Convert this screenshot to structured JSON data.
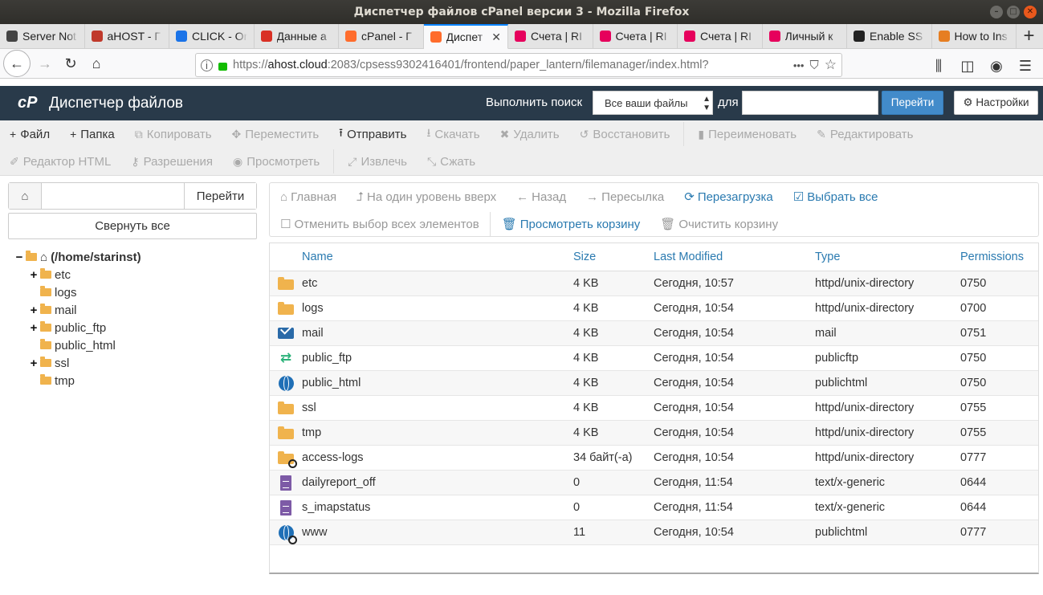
{
  "window": {
    "title": "Диспетчер файлов cPanel версии 3 - Mozilla Firefox"
  },
  "tabs": [
    {
      "label": "Server Not",
      "icon": "warning-icon",
      "color": "#444444"
    },
    {
      "label": "aHOST - Г",
      "icon": "ahost-icon",
      "color": "#c0392b"
    },
    {
      "label": "CLICK - On",
      "icon": "click-icon",
      "color": "#1a73e8"
    },
    {
      "label": "Данные а",
      "icon": "gmail-icon",
      "color": "#d93025"
    },
    {
      "label": "cPanel - Г",
      "icon": "cpanel-icon",
      "color": "#ff6c2c"
    },
    {
      "label": "Диспет",
      "icon": "cpanel-icon",
      "color": "#ff6c2c",
      "active": true
    },
    {
      "label": "Счета | RI",
      "icon": "ri-icon",
      "color": "#e6005c"
    },
    {
      "label": "Счета | RI",
      "icon": "ri-icon",
      "color": "#e6005c"
    },
    {
      "label": "Счета | RI",
      "icon": "ri-icon",
      "color": "#e6005c"
    },
    {
      "label": "Личный к",
      "icon": "ri-icon",
      "color": "#e6005c"
    },
    {
      "label": "Enable SS",
      "icon": "linux-icon",
      "color": "#222222"
    },
    {
      "label": "How to Ins",
      "icon": "howto-icon",
      "color": "#e67e22"
    }
  ],
  "url": {
    "prefix": "https://",
    "host": "ahost.cloud",
    "rest": ":2083/cpsess9302416401/frontend/paper_lantern/filemanager/index.html?",
    "dots": "•••"
  },
  "cpanel": {
    "logo": "cP",
    "title": "Диспетчер файлов",
    "search_label": "Выполнить поиск",
    "search_scope": "Все ваши файлы",
    "for_label": "для",
    "go": "Перейти",
    "settings": "Настройки"
  },
  "toolbar": {
    "row1": [
      {
        "label": "Файл",
        "icon": "+",
        "enabled": true
      },
      {
        "label": "Папка",
        "icon": "+",
        "enabled": true
      },
      {
        "label": "Копировать",
        "icon": "⧉",
        "enabled": false
      },
      {
        "label": "Переместить",
        "icon": "✥",
        "enabled": false
      },
      {
        "label": "Отправить",
        "icon": "⭱",
        "enabled": true
      },
      {
        "label": "Скачать",
        "icon": "⭳",
        "enabled": false
      },
      {
        "label": "Удалить",
        "icon": "✖",
        "enabled": false
      },
      {
        "label": "Восстановить",
        "icon": "↺",
        "enabled": false
      },
      {
        "label": "Переименовать",
        "icon": "▮",
        "enabled": false
      },
      {
        "label": "Редактировать",
        "icon": "✎",
        "enabled": false
      }
    ],
    "row2": [
      {
        "label": "Редактор HTML",
        "icon": "✐",
        "enabled": false
      },
      {
        "label": "Разрешения",
        "icon": "⚷",
        "enabled": false
      },
      {
        "label": "Просмотреть",
        "icon": "◉",
        "enabled": false
      },
      {
        "label": "Извлечь",
        "icon": "⤢",
        "enabled": false
      },
      {
        "label": "Сжать",
        "icon": "⤡",
        "enabled": false
      }
    ]
  },
  "left": {
    "go": "Перейти",
    "collapse": "Свернуть все",
    "tree_root": "(/home/starinst)",
    "tree": [
      {
        "name": "etc",
        "expandable": true
      },
      {
        "name": "logs",
        "expandable": false
      },
      {
        "name": "mail",
        "expandable": true
      },
      {
        "name": "public_ftp",
        "expandable": true
      },
      {
        "name": "public_html",
        "expandable": false
      },
      {
        "name": "ssl",
        "expandable": true
      },
      {
        "name": "tmp",
        "expandable": false
      }
    ]
  },
  "actions": {
    "row1": [
      {
        "label": "Главная",
        "icon": "home-icon",
        "glyph": "⌂",
        "enabled": false
      },
      {
        "label": "На один уровень вверх",
        "icon": "level-up-icon",
        "glyph": "⮥",
        "enabled": false
      },
      {
        "label": "Назад",
        "icon": "arrow-left-icon",
        "glyph": "←",
        "enabled": false
      },
      {
        "label": "Пересылка",
        "icon": "arrow-right-icon",
        "glyph": "→",
        "enabled": false
      },
      {
        "label": "Перезагрузка",
        "icon": "refresh-icon",
        "glyph": "⟳",
        "enabled": true
      },
      {
        "label": "Выбрать все",
        "icon": "checkbox-checked-icon",
        "glyph": "☑",
        "enabled": true
      }
    ],
    "row2": [
      {
        "label": "Отменить выбор всех элементов",
        "icon": "checkbox-icon",
        "glyph": "☐",
        "enabled": false
      },
      {
        "label": "Просмотреть корзину",
        "icon": "trash-icon",
        "glyph": "🗑",
        "enabled": true
      },
      {
        "label": "Очистить корзину",
        "icon": "trash-icon",
        "glyph": "🗑",
        "enabled": false
      }
    ]
  },
  "table": {
    "headers": {
      "name": "Name",
      "size": "Size",
      "modified": "Last Modified",
      "type": "Type",
      "perms": "Permissions"
    },
    "rows": [
      {
        "icon": "folder",
        "name": "etc",
        "size": "4 KB",
        "modified": "Сегодня, 10:57",
        "type": "httpd/unix-directory",
        "perms": "0750"
      },
      {
        "icon": "folder",
        "name": "logs",
        "size": "4 KB",
        "modified": "Сегодня, 10:54",
        "type": "httpd/unix-directory",
        "perms": "0700"
      },
      {
        "icon": "mail",
        "name": "mail",
        "size": "4 KB",
        "modified": "Сегодня, 10:54",
        "type": "mail",
        "perms": "0751"
      },
      {
        "icon": "ftp",
        "name": "public_ftp",
        "size": "4 KB",
        "modified": "Сегодня, 10:54",
        "type": "publicftp",
        "perms": "0750"
      },
      {
        "icon": "web",
        "name": "public_html",
        "size": "4 KB",
        "modified": "Сегодня, 10:54",
        "type": "publichtml",
        "perms": "0750"
      },
      {
        "icon": "folder",
        "name": "ssl",
        "size": "4 KB",
        "modified": "Сегодня, 10:54",
        "type": "httpd/unix-directory",
        "perms": "0755"
      },
      {
        "icon": "folder",
        "name": "tmp",
        "size": "4 KB",
        "modified": "Сегодня, 10:54",
        "type": "httpd/unix-directory",
        "perms": "0755"
      },
      {
        "icon": "folder-link",
        "name": "access-logs",
        "size": "34 байт(-а)",
        "modified": "Сегодня, 10:54",
        "type": "httpd/unix-directory",
        "perms": "0777"
      },
      {
        "icon": "doc",
        "name": "dailyreport_off",
        "size": "0",
        "modified": "Сегодня, 11:54",
        "type": "text/x-generic",
        "perms": "0644"
      },
      {
        "icon": "doc",
        "name": "s_imapstatus",
        "size": "0",
        "modified": "Сегодня, 11:54",
        "type": "text/x-generic",
        "perms": "0644"
      },
      {
        "icon": "web-link",
        "name": "www",
        "size": "11",
        "modified": "Сегодня, 10:54",
        "type": "publichtml",
        "perms": "0777"
      }
    ]
  }
}
